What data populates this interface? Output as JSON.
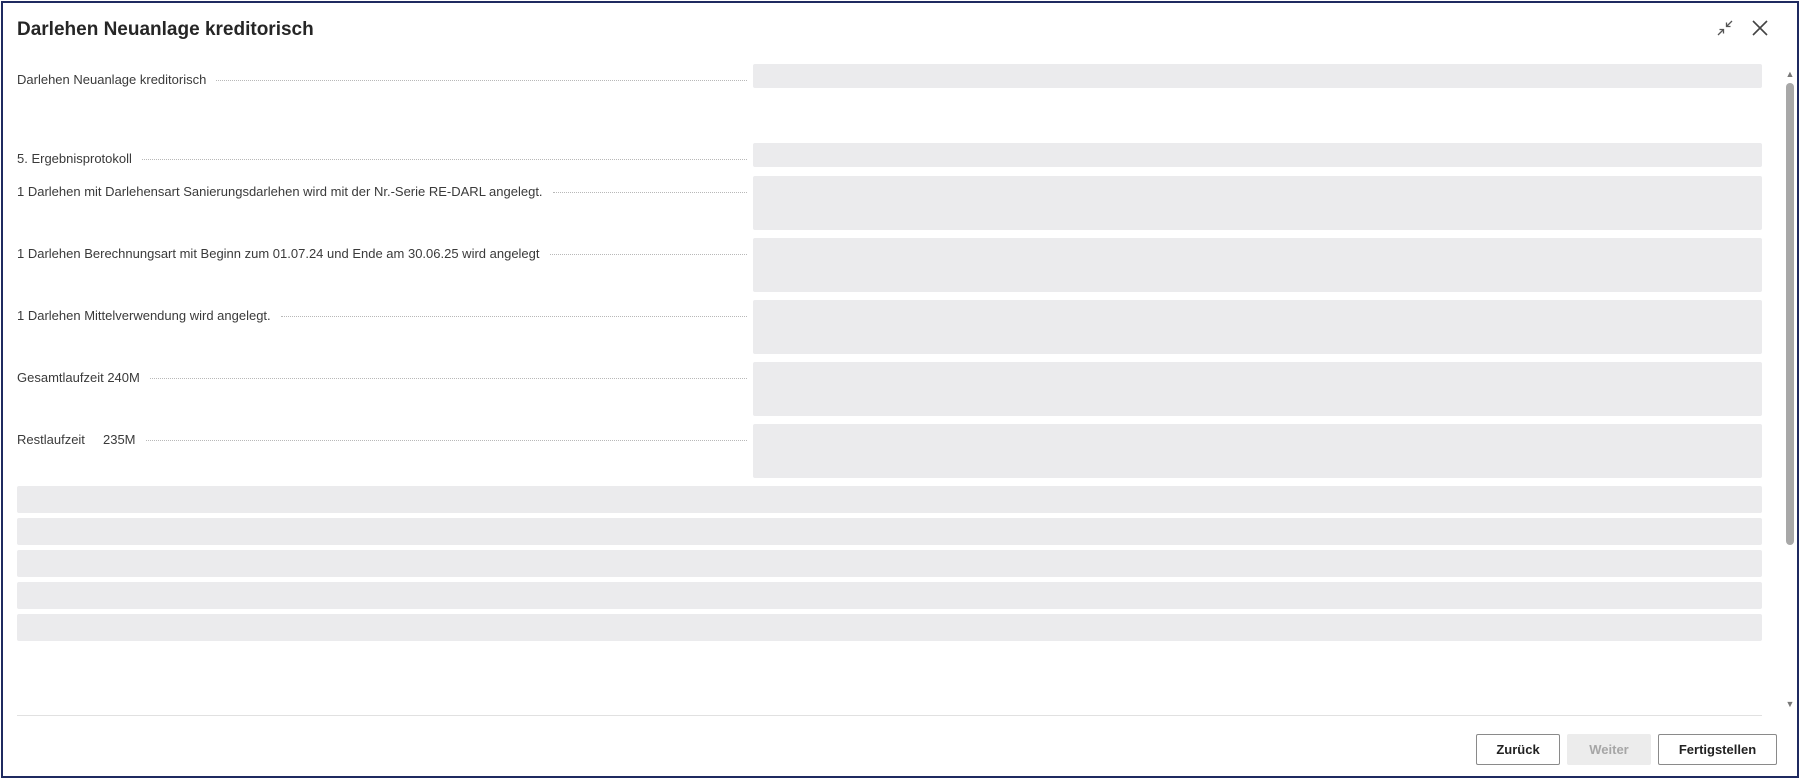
{
  "dialog": {
    "title": "Darlehen Neuanlage kreditorisch",
    "icons": {
      "collapse": "collapse-icon",
      "close": "close-icon"
    }
  },
  "fields": [
    {
      "label": "Darlehen Neuanlage kreditorisch",
      "value": ""
    },
    {
      "label": "5. Ergebnisprotokoll",
      "value": ""
    },
    {
      "label": "1 Darlehen mit Darlehensart Sanierungsdarlehen wird mit der Nr.-Serie RE-DARL angelegt.",
      "value": ""
    },
    {
      "label": "1 Darlehen Berechnungsart mit Beginn zum 01.07.24 und Ende am 30.06.25 wird angelegt",
      "value": ""
    },
    {
      "label": "1 Darlehen Mittelverwendung wird angelegt.",
      "value": ""
    },
    {
      "label": "Gesamtlaufzeit 240M",
      "value": ""
    },
    {
      "label": "Restlaufzeit     235M",
      "value": ""
    }
  ],
  "buttons": {
    "back": "Zurück",
    "next": "Weiter",
    "finish": "Fertigstellen"
  },
  "colors": {
    "border": "#1f2a60",
    "field_bg": "#ebebed",
    "disabled_bg": "#ececec"
  }
}
